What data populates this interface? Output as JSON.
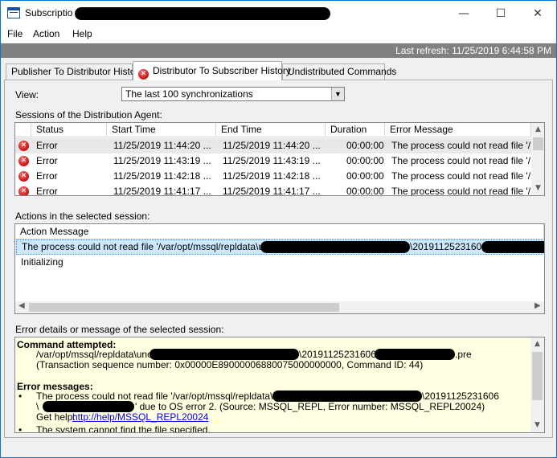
{
  "window": {
    "title": "Subscriptio",
    "minimize_glyph": "—",
    "maximize_glyph": "☐",
    "close_glyph": "✕"
  },
  "menu": [
    "File",
    "Action",
    "Help"
  ],
  "status": {
    "last_refresh": "Last refresh: 11/25/2019 6:44:58 PM"
  },
  "tabs": [
    {
      "label": "Publisher To Distributor History",
      "active": false
    },
    {
      "label": "Distributor To Subscriber History",
      "active": true,
      "icon": "error-icon"
    },
    {
      "label": "Undistributed Commands",
      "active": false
    }
  ],
  "view": {
    "label": "View:",
    "selected": "The last 100 synchronizations"
  },
  "sessions": {
    "label": "Sessions of the Distribution Agent:",
    "columns": [
      "Status",
      "Start Time",
      "End Time",
      "Duration",
      "Error Message"
    ],
    "rows": [
      {
        "status": "Error",
        "start": "11/25/2019 11:44:20 ...",
        "end": "11/25/2019 11:44:20 ...",
        "duration": "00:00:00",
        "message": "The process could not read file '/..."
      },
      {
        "status": "Error",
        "start": "11/25/2019 11:43:19 ...",
        "end": "11/25/2019 11:43:19 ...",
        "duration": "00:00:00",
        "message": "The process could not read file '/..."
      },
      {
        "status": "Error",
        "start": "11/25/2019 11:42:18 ...",
        "end": "11/25/2019 11:42:18 ...",
        "duration": "00:00:00",
        "message": "The process could not read file '/..."
      },
      {
        "status": "Error",
        "start": "11/25/2019 11:41:17 ...",
        "end": "11/25/2019 11:41:17 ...",
        "duration": "00:00:00",
        "message": "The process could not read file '/..."
      }
    ]
  },
  "actions": {
    "label": "Actions in the selected session:",
    "column": "Action Message",
    "rows": [
      {
        "pre": "The process could not read file '/var/opt/mssql/repldata\\unc\\",
        "post": "\\20191125231606\\"
      },
      {
        "pre": "Initializing",
        "post": ""
      }
    ]
  },
  "details": {
    "label": "Error details or message of the selected session:",
    "command_heading": "Command attempted:",
    "command_line1_pre": "/var/opt/mssql/repldata\\unc\\",
    "command_line1_mid": "\\20191125231606\\",
    "command_line1_post": ".pre",
    "command_line2": "(Transaction sequence number: 0x00000E89000006880075000000000, Command ID: 44)",
    "errors_heading": "Error messages:",
    "error1_line1_pre": "The process could not read file '/var/opt/mssql/repldata\\unc\\",
    "error1_line1_post": "\\20191125231606",
    "error1_line2_pre": "\\",
    "error1_line2_post": "' due to OS error 2. (Source: MSSQL_REPL, Error number: MSSQL_REPL20024)",
    "error1_help_label": "Get help: ",
    "error1_help_link": "http://help/MSSQL_REPL20024",
    "error2_line1": "The system cannot find the file specified."
  }
}
